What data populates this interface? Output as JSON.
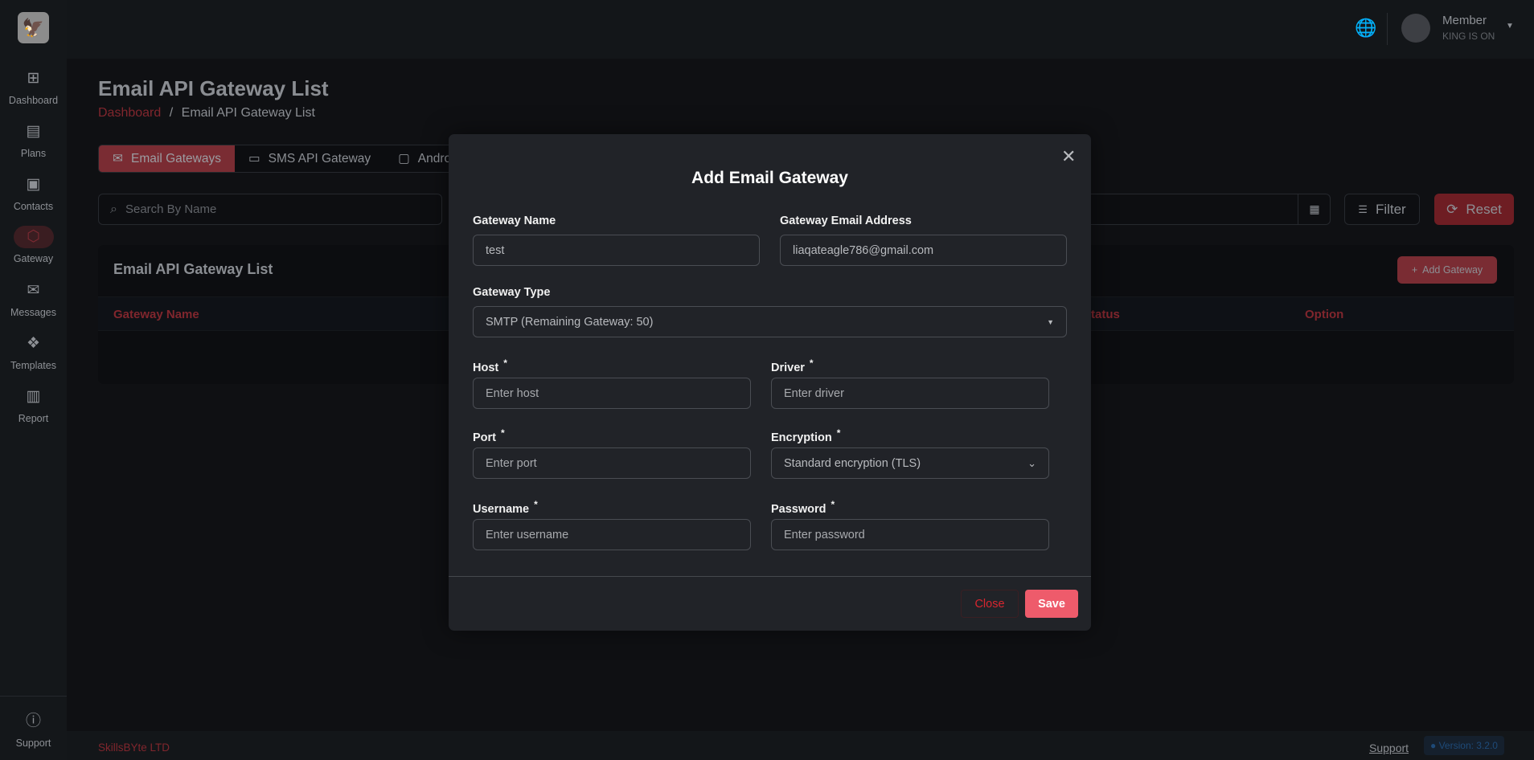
{
  "sidebar": {
    "logo_icon": "eagle-logo",
    "items": [
      {
        "label": "Dashboard",
        "icon": "grid-icon"
      },
      {
        "label": "Plans",
        "icon": "newspaper-icon"
      },
      {
        "label": "Contacts",
        "icon": "contact-book-icon"
      },
      {
        "label": "Gateway",
        "icon": "cube-icon",
        "active": true
      },
      {
        "label": "Messages",
        "icon": "mail-send-icon"
      },
      {
        "label": "Templates",
        "icon": "layers-icon"
      },
      {
        "label": "Report",
        "icon": "bar-chart-icon"
      }
    ],
    "support": "Support"
  },
  "header": {
    "user_name": "Member",
    "user_subtitle": "KING IS ON"
  },
  "page": {
    "title": "Email API Gateway List",
    "breadcrumb": [
      "Dashboard",
      "Email API Gateway List"
    ],
    "tabs": [
      "Email Gateways",
      "SMS API Gateway",
      "Android"
    ],
    "search_placeholder": "Search By Name",
    "filter": "Filter",
    "reset": "Reset",
    "card_title": "Email API Gateway List",
    "add_gateway": "Add Gateway",
    "columns": [
      "Gateway Name",
      "Status",
      "Option"
    ]
  },
  "footer": {
    "company": "SkillsBYte LTD",
    "support": "Support",
    "version": "Version: 3.2.0"
  },
  "modal": {
    "title": "Add Email Gateway",
    "gateway_name_label": "Gateway Name",
    "gateway_name_value": "test",
    "email_label": "Gateway Email Address",
    "email_value": "liaqateagle786@gmail.com",
    "type_label": "Gateway Type",
    "type_value": "SMTP (Remaining Gateway: 50)",
    "host_label": "Host",
    "host_placeholder": "Enter host",
    "driver_label": "Driver",
    "driver_placeholder": "Enter driver",
    "port_label": "Port",
    "port_placeholder": "Enter port",
    "encryption_label": "Encryption",
    "encryption_value": "Standard encryption (TLS)",
    "username_label": "Username",
    "username_placeholder": "Enter username",
    "password_label": "Password",
    "password_placeholder": "Enter password",
    "required_mark": "*",
    "close": "Close",
    "save": "Save"
  },
  "colors": {
    "accent": "#ee5b6b",
    "modal_bg": "#212328",
    "brand_red": "#80262d"
  }
}
